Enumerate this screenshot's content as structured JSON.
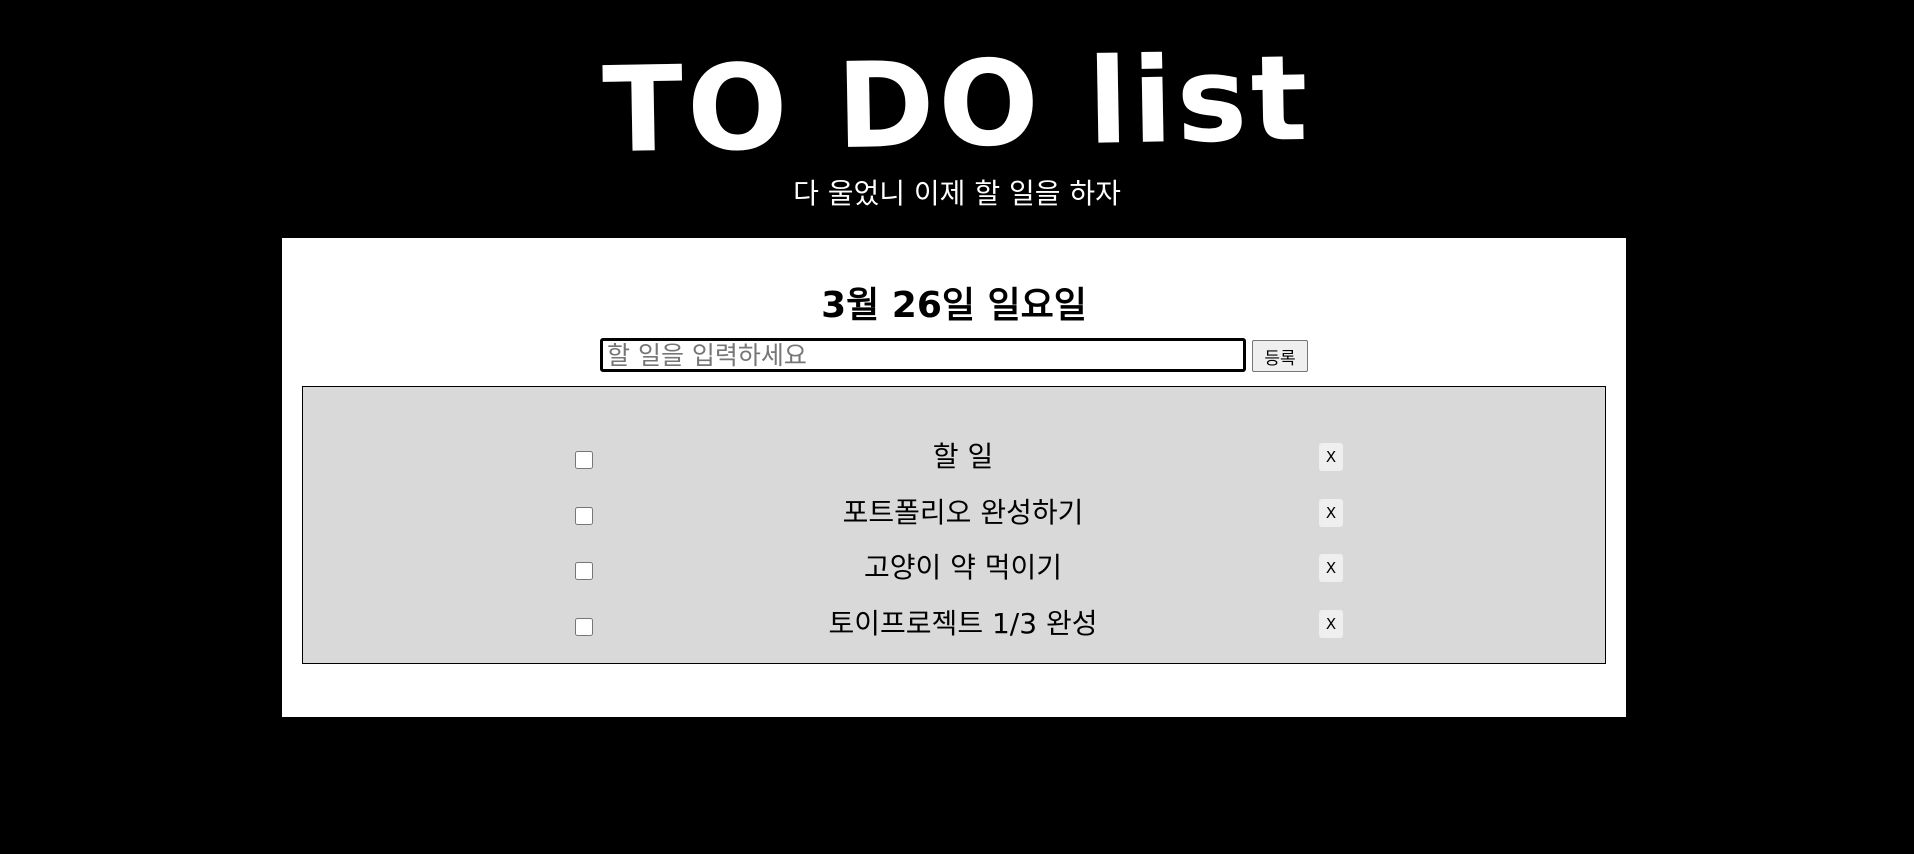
{
  "header": {
    "title": "TO DO list",
    "subtitle": "다 울었니 이제 할 일을 하자"
  },
  "main": {
    "date": "3월 26일 일요일",
    "input": {
      "placeholder": "할 일을 입력하세요",
      "value": ""
    },
    "register_label": "등록",
    "todos": [
      {
        "text": "할 일",
        "checked": false,
        "delete_label": "X"
      },
      {
        "text": "포트폴리오 완성하기",
        "checked": false,
        "delete_label": "X"
      },
      {
        "text": "고양이 약 먹이기",
        "checked": false,
        "delete_label": "X"
      },
      {
        "text": "토이프로젝트 1/3 완성",
        "checked": false,
        "delete_label": "X"
      }
    ]
  },
  "colors": {
    "page_background": "#000000",
    "card_background": "#ffffff",
    "list_background": "#d9d9d9",
    "text_primary": "#000000",
    "text_inverse": "#ffffff"
  }
}
